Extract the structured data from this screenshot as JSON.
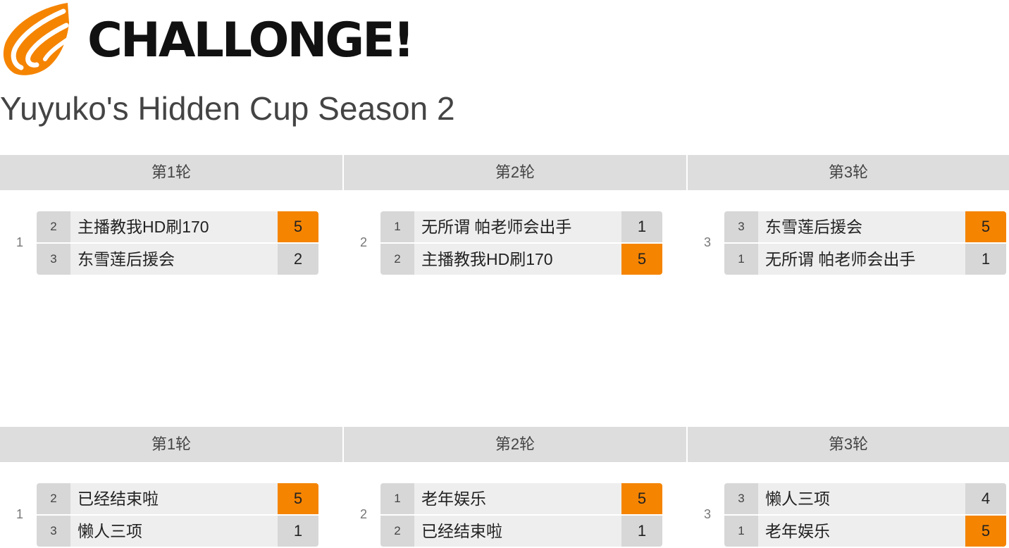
{
  "brand": {
    "name": "CHALLONGE!",
    "mark_icon": "flame-logo-icon",
    "accent": "#F58400"
  },
  "tournament": {
    "title": "Yuyuko's Hidden Cup Season 2"
  },
  "colors": {
    "header_bg": "#DDDDDD",
    "row_bg": "#EEEEEE",
    "seed_bg": "#D7D7D7",
    "winner": "#F58400"
  },
  "groups": [
    {
      "rounds": [
        "第1轮",
        "第2轮",
        "第3轮"
      ],
      "matches": [
        {
          "id": "1",
          "top": {
            "seed": "2",
            "name": "主播教我HD刷170",
            "score": "5",
            "winner": true
          },
          "bottom": {
            "seed": "3",
            "name": "东雪莲后援会",
            "score": "2",
            "winner": false
          }
        },
        {
          "id": "2",
          "top": {
            "seed": "1",
            "name": "无所谓 帕老师会出手",
            "score": "1",
            "winner": false
          },
          "bottom": {
            "seed": "2",
            "name": "主播教我HD刷170",
            "score": "5",
            "winner": true
          }
        },
        {
          "id": "3",
          "top": {
            "seed": "3",
            "name": "东雪莲后援会",
            "score": "5",
            "winner": true
          },
          "bottom": {
            "seed": "1",
            "name": "无所谓 帕老师会出手",
            "score": "1",
            "winner": false
          }
        }
      ]
    },
    {
      "rounds": [
        "第1轮",
        "第2轮",
        "第3轮"
      ],
      "matches": [
        {
          "id": "1",
          "top": {
            "seed": "2",
            "name": "已经结束啦",
            "score": "5",
            "winner": true
          },
          "bottom": {
            "seed": "3",
            "name": "懒人三项",
            "score": "1",
            "winner": false
          }
        },
        {
          "id": "2",
          "top": {
            "seed": "1",
            "name": "老年娱乐",
            "score": "5",
            "winner": true
          },
          "bottom": {
            "seed": "2",
            "name": "已经结束啦",
            "score": "1",
            "winner": false
          }
        },
        {
          "id": "3",
          "top": {
            "seed": "3",
            "name": "懒人三项",
            "score": "4",
            "winner": false
          },
          "bottom": {
            "seed": "1",
            "name": "老年娱乐",
            "score": "5",
            "winner": true
          }
        }
      ]
    }
  ]
}
